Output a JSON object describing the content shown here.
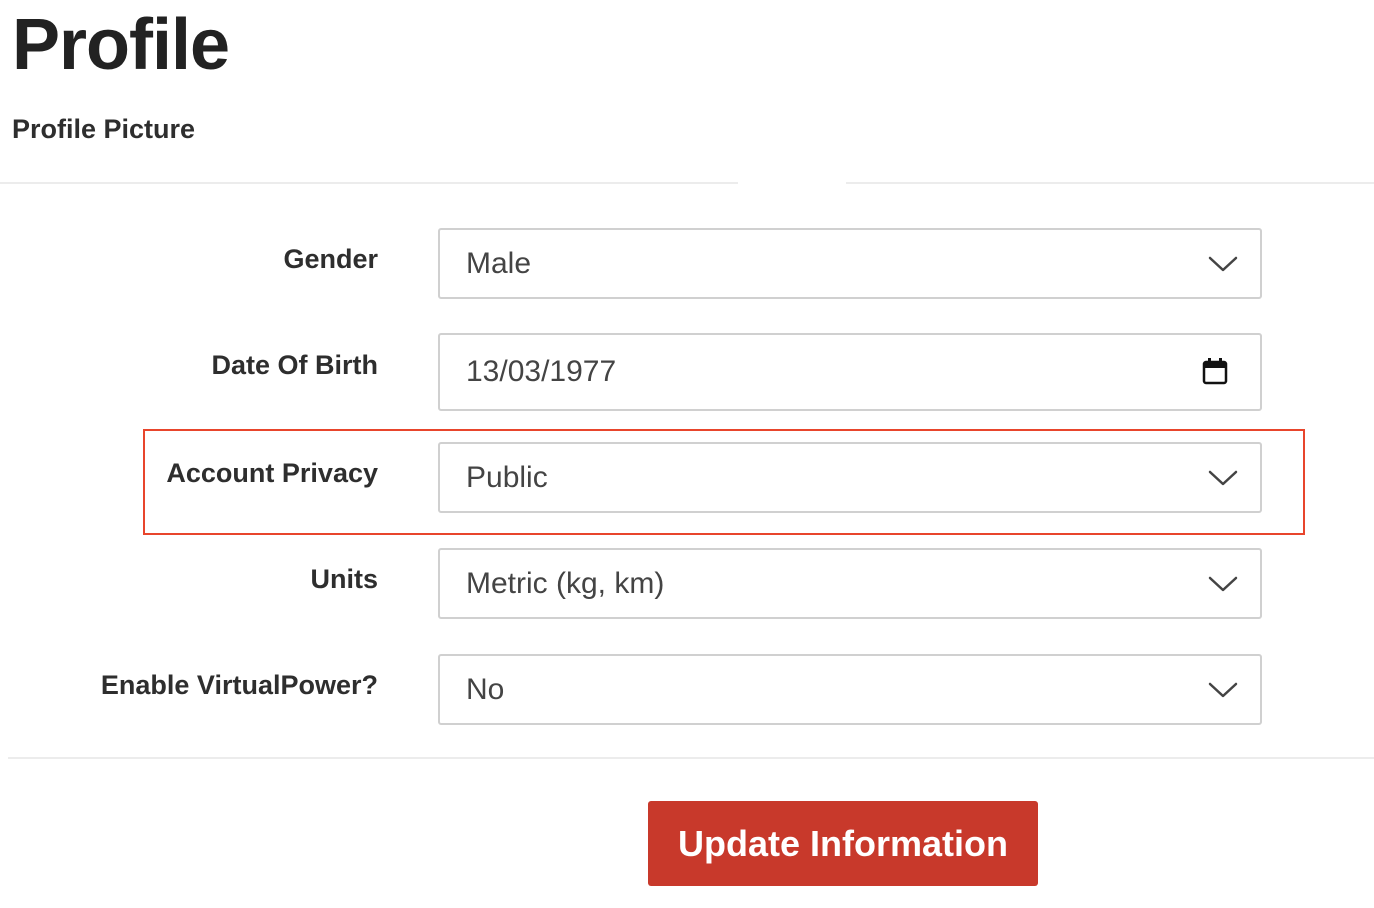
{
  "page": {
    "title": "Profile",
    "section_title": "Profile Picture"
  },
  "form": {
    "gender": {
      "label": "Gender",
      "value": "Male",
      "icon": "chevron-down-icon"
    },
    "date_of_birth": {
      "label": "Date Of Birth",
      "value": "13/03/1977",
      "icon": "calendar-icon"
    },
    "account_privacy": {
      "label": "Account Privacy",
      "value": "Public",
      "icon": "chevron-down-icon",
      "highlighted": true
    },
    "units": {
      "label": "Units",
      "value": "Metric (kg, km)",
      "icon": "chevron-down-icon"
    },
    "virtual_power": {
      "label": "Enable VirtualPower?",
      "value": "No",
      "icon": "chevron-down-icon"
    }
  },
  "actions": {
    "update_label": "Update Information"
  },
  "colors": {
    "accent": "#c8392b",
    "highlight": "#e8452c",
    "border": "#d0d0d0",
    "divider": "#ececec",
    "text": "#2e2e2e"
  }
}
